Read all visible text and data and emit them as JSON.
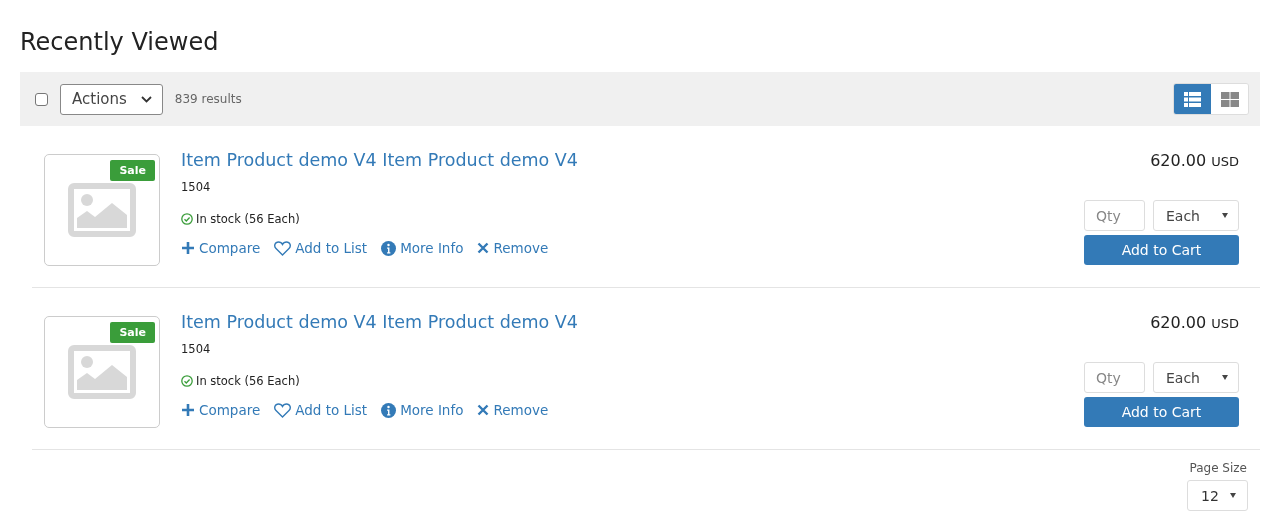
{
  "title": "Recently Viewed",
  "toolbar": {
    "select_all": {
      "checked": false
    },
    "actions": "Actions",
    "results": "839 results",
    "views": [
      {
        "kind": "list",
        "selected": true
      },
      {
        "kind": "grid",
        "selected": false
      }
    ]
  },
  "products": [
    {
      "badge": "Sale",
      "name": "Item Product demo V4 Item Product demo V4",
      "sku": "1504",
      "stock": "In stock (56 Each)",
      "links": [
        {
          "kind": "compare",
          "label": "Compare"
        },
        {
          "kind": "list",
          "label": "Add to List"
        },
        {
          "kind": "info",
          "label": "More Info"
        },
        {
          "kind": "remove",
          "label": "Remove"
        }
      ],
      "price": "620.00",
      "currency": "USD",
      "qty_placeholder": "Qty",
      "unit": "Each",
      "button": "Add to Cart"
    },
    {
      "badge": "Sale",
      "name": "Item Product demo V4 Item Product demo V4",
      "sku": "1504",
      "stock": "In stock (56 Each)",
      "links": [
        {
          "kind": "compare",
          "label": "Compare"
        },
        {
          "kind": "list",
          "label": "Add to List"
        },
        {
          "kind": "info",
          "label": "More Info"
        },
        {
          "kind": "remove",
          "label": "Remove"
        }
      ],
      "price": "620.00",
      "currency": "USD",
      "qty_placeholder": "Qty",
      "unit": "Each",
      "button": "Add to Cart"
    }
  ],
  "pager": {
    "label": "Page Size",
    "value": "12"
  }
}
